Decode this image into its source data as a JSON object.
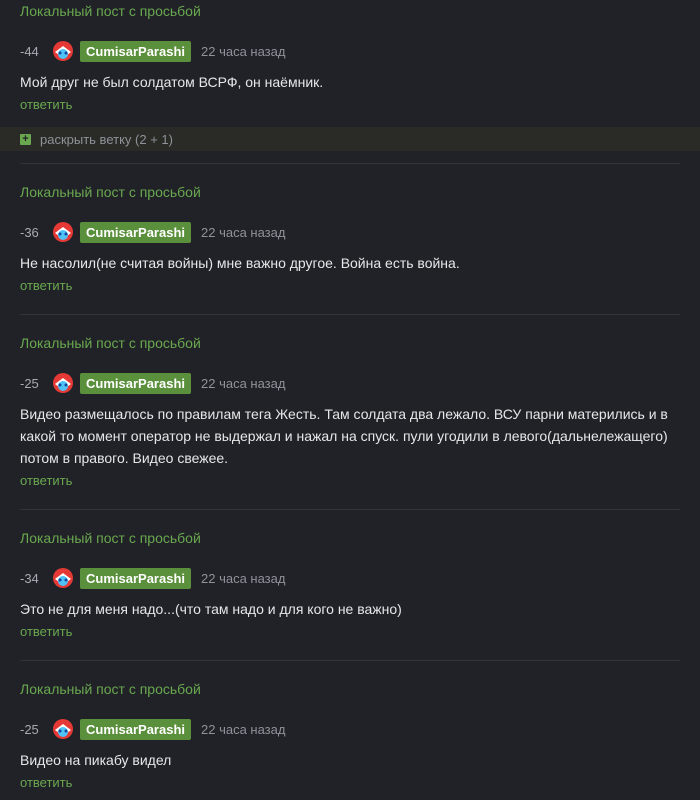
{
  "comments": [
    {
      "post_title": "Локальный пост с просьбой",
      "rating": "-44",
      "username": "CumisarParashi",
      "time": "22 часа назад",
      "text": "Мой друг не был солдатом ВСРФ, он наёмник.",
      "reply_label": "ответить",
      "expand_label": "раскрыть ветку (2 + 1)"
    },
    {
      "post_title": "Локальный пост с просьбой",
      "rating": "-36",
      "username": "CumisarParashi",
      "time": "22 часа назад",
      "text": "Не насолил(не считая войны) мне важно другое. Война есть война.",
      "reply_label": "ответить"
    },
    {
      "post_title": "Локальный пост с просьбой",
      "rating": "-25",
      "username": "CumisarParashi",
      "time": "22 часа назад",
      "text": "Видео размещалось по правилам тега Жесть. Там солдата два лежало. ВСУ парни матерились и в какой то момент оператор не выдержал и нажал на спуск. пули угодили в левого(дальнележащего) потом в правого. Видео свежее.",
      "reply_label": "ответить"
    },
    {
      "post_title": "Локальный пост с просьбой",
      "rating": "-34",
      "username": "CumisarParashi",
      "time": "22 часа назад",
      "text": "Это не для меня надо...(что там надо и для кого не важно)",
      "reply_label": "ответить"
    },
    {
      "post_title": "Локальный пост с просьбой",
      "rating": "-25",
      "username": "CumisarParashi",
      "time": "22 часа назад",
      "text": "Видео на пикабу видел",
      "reply_label": "ответить"
    }
  ],
  "colors": {
    "background": "#202227",
    "accent_green": "#6aa84f",
    "username_badge": "#5a8f3c",
    "text": "#e6e7e9",
    "muted": "#8e9299"
  },
  "icons": {
    "avatar": "avatar-icon",
    "expand": "plus-square-icon"
  }
}
